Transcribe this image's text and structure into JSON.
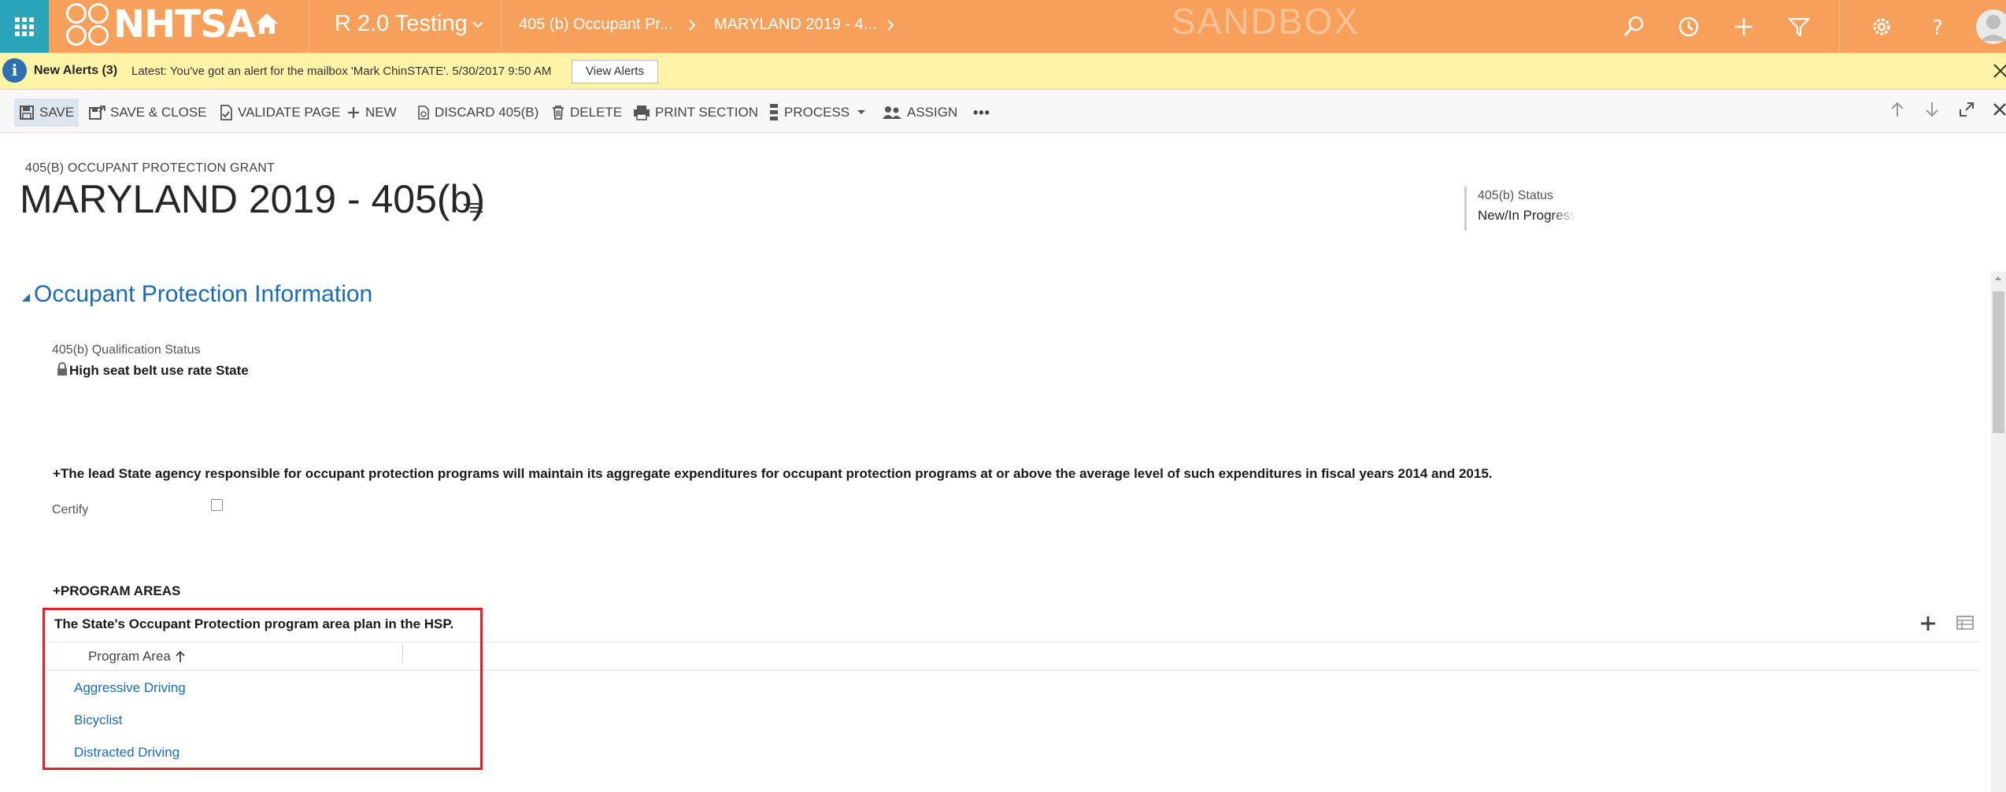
{
  "topbar": {
    "logo_text": "NHTSA",
    "app_name": "R 2.0 Testing",
    "crumbs": [
      "405 (b) Occupant Pr...",
      "MARYLAND 2019 - 4..."
    ],
    "environment": "SANDBOX",
    "icons": [
      "app-launcher-icon",
      "home-icon",
      "search-icon",
      "history-icon",
      "plus-icon",
      "filter-icon",
      "gear-icon",
      "help-icon",
      "user-avatar-icon"
    ]
  },
  "alert": {
    "title": "New Alerts (3)",
    "message": "Latest: You've got an alert for the mailbox 'Mark ChinSTATE'. 5/30/2017 9:50 AM",
    "button": "View Alerts"
  },
  "commands": {
    "save": "SAVE",
    "save_close": "SAVE & CLOSE",
    "validate": "VALIDATE PAGE",
    "new": "NEW",
    "discard": "DISCARD 405(B)",
    "delete": "DELETE",
    "print": "PRINT SECTION",
    "process": "PROCESS",
    "assign": "ASSIGN",
    "more": "•••"
  },
  "header": {
    "entity_type": "405(B) OCCUPANT PROTECTION GRANT",
    "title": "MARYLAND 2019 - 405(b)",
    "status_label": "405(b) Status",
    "status_value": "New/In Progress"
  },
  "section": {
    "title": "Occupant Protection Information",
    "qualification_label": "405(b) Qualification Status",
    "qualification_value": "High seat belt use rate State",
    "certify_statement": "+The lead State agency responsible for occupant protection programs will maintain its aggregate expenditures for occupant protection programs at or above the average level of such expenditures in fiscal years 2014 and 2015.",
    "certify_label": "Certify",
    "certify_checked": false,
    "program_areas_heading": "+PROGRAM AREAS"
  },
  "subgrid": {
    "title": "The State's Occupant Protection program area plan in the HSP.",
    "column": "Program Area",
    "sort": "ascending",
    "rows": [
      "Aggressive Driving",
      "Bicyclist",
      "Distracted Driving"
    ]
  },
  "colors": {
    "nav_orange": "#f7a05b",
    "launcher_teal": "#2aa4b8",
    "alert_yellow": "#fff3a8",
    "link_blue": "#1d6bb3",
    "highlight_red": "#e0202a"
  }
}
